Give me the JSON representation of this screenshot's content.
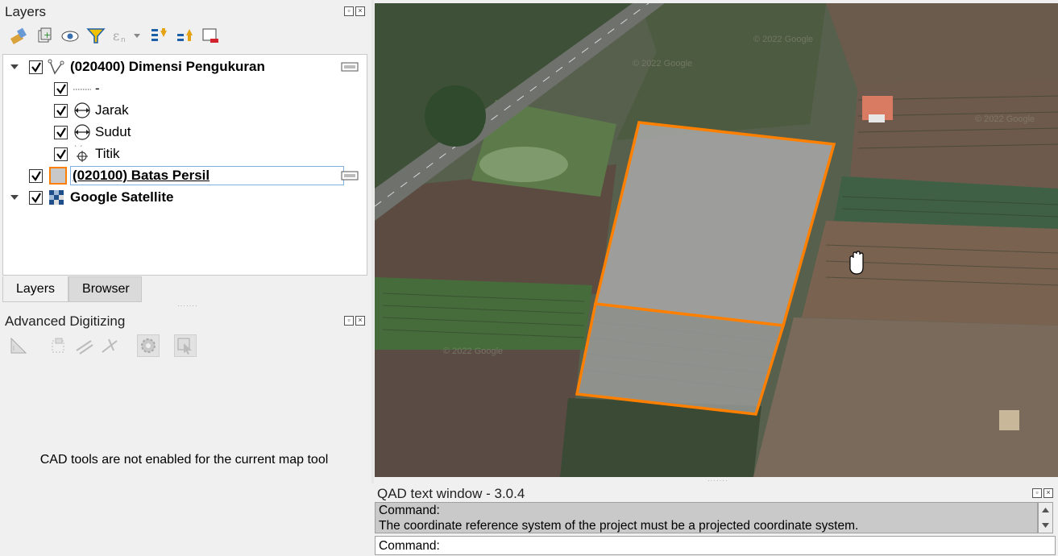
{
  "layers_panel": {
    "title": "Layers",
    "toolbar_icons": [
      "style-manager-icon",
      "add-group-icon",
      "visibility-eye-icon",
      "filter-legend-icon",
      "expression-filter-icon",
      "expand-all-icon",
      "collapse-all-icon",
      "remove-layer-icon"
    ],
    "tree": [
      {
        "label": "(020400) Dimensi Pengukuran",
        "bold": true,
        "checked": true,
        "expanded": true,
        "icon": "vector-line-icon",
        "children": [
          {
            "label": "-",
            "icon": "dotted-line-icon",
            "checked": true
          },
          {
            "label": "Jarak",
            "icon": "dimension-arrow-icon",
            "checked": true
          },
          {
            "label": "Sudut",
            "icon": "dimension-arrow-icon",
            "checked": true
          },
          {
            "label": "Titik",
            "icon": "point-target-icon",
            "checked": true
          }
        ]
      },
      {
        "label": "(020100) Batas Persil",
        "bold": true,
        "underline": true,
        "checked": true,
        "selected": true,
        "icon": "polygon-fill-icon"
      },
      {
        "label": "Google Satellite",
        "bold": true,
        "checked": true,
        "expanded": true,
        "icon": "raster-tiles-icon"
      }
    ]
  },
  "tabs": [
    {
      "label": "Layers",
      "active": true
    },
    {
      "label": "Browser",
      "active": false
    }
  ],
  "advanced_digitizing": {
    "title": "Advanced Digitizing",
    "message": "CAD tools are not enabled for the current map tool",
    "toolbar_icons": [
      "cad-enable-icon",
      "construction-mode-icon",
      "parallel-icon",
      "perpendicular-icon",
      "cad-settings-icon",
      "floater-icon"
    ]
  },
  "map": {
    "cursor": "hand-pan-icon",
    "polygon_stroke_color": "#ff8000",
    "watermark": "© 2022 Google"
  },
  "qad": {
    "title": "QAD text window - 3.0.4",
    "lines": [
      "Command:",
      "The coordinate reference system of the project must be a projected coordinate system."
    ],
    "command_prompt": "Command:"
  }
}
